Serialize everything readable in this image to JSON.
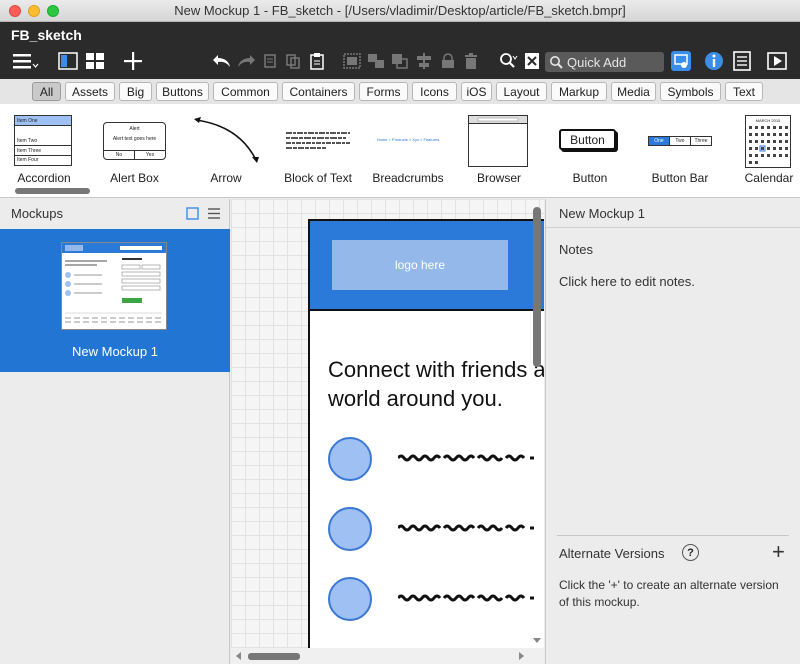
{
  "window": {
    "title": "New Mockup 1 - FB_sketch - [/Users/vladimir/Desktop/article/FB_sketch.bmpr]",
    "traffic_lights": {
      "close": "#fc5f57",
      "minimize": "#fdbc2e",
      "zoom": "#29c840"
    }
  },
  "app": {
    "name": "FB_sketch"
  },
  "toolbar": {
    "quick_add_placeholder": "Quick Add",
    "icons": [
      "menu-icon",
      "panel-toggle-icon",
      "grid-view-icon",
      "add-icon",
      "undo-icon",
      "redo-icon",
      "cut-icon",
      "copy-icon",
      "paste-icon",
      "group-icon",
      "ungroup-icon",
      "bring-front-icon",
      "align-icon",
      "lock-icon",
      "trash-icon",
      "search-icon",
      "close-box-icon",
      "quick-add-search-icon",
      "linked-icon",
      "info-icon",
      "notes-icon",
      "play-icon"
    ]
  },
  "filters": {
    "items": [
      "All",
      "Assets",
      "Big",
      "Buttons",
      "Common",
      "Containers",
      "Forms",
      "Icons",
      "iOS",
      "Layout",
      "Markup",
      "Media",
      "Symbols",
      "Text"
    ],
    "active": "All"
  },
  "library": {
    "items": [
      "Accordion",
      "Alert Box",
      "Arrow",
      "Block of Text",
      "Breadcrumbs",
      "Browser",
      "Button",
      "Button Bar",
      "Calendar"
    ],
    "accordion_rows": [
      "Item One",
      "Item Two",
      "Item Three",
      "Item Four"
    ],
    "alert_title": "Alert",
    "alert_text": "Alert text goes here",
    "alert_buttons": [
      "No",
      "Yes"
    ],
    "breadcrumb_text": "Home > Products > Xyz > Features",
    "button_text": "Button",
    "button_bar": [
      "One",
      "Two",
      "Three"
    ],
    "calendar_header": "MARCH 2015"
  },
  "mockups_panel": {
    "title": "Mockups",
    "items": [
      {
        "label": "New Mockup 1"
      }
    ]
  },
  "canvas": {
    "logo_text": "logo here",
    "headline": "Connect with friends and the world around you.",
    "accent": "#2b79d8"
  },
  "inspector": {
    "title": "New Mockup 1",
    "notes_label": "Notes",
    "notes_hint": "Click here to edit notes.",
    "alt_label": "Alternate Versions",
    "alt_help": "?",
    "alt_add": "+",
    "alt_hint": "Click the '+' to create an alternate version of this mockup."
  }
}
